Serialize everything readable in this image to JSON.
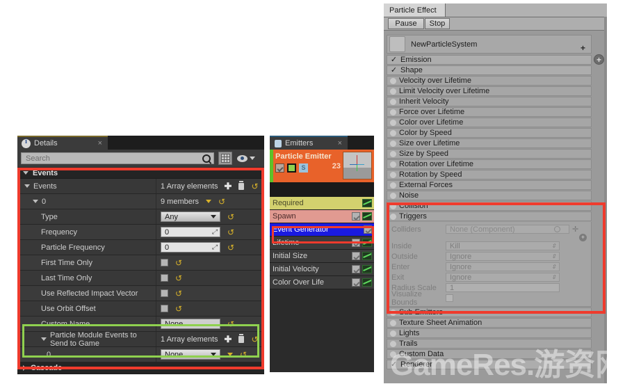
{
  "details_panel": {
    "tab": {
      "title": "Details",
      "icon": "info-icon",
      "close": "×"
    },
    "search": {
      "placeholder": "Search",
      "magnifier_icon": "search-icon",
      "grid_icon": "grid-view-icon",
      "eye_icon": "eye-icon"
    },
    "category": {
      "label": "Events"
    },
    "rows": [
      {
        "label": "Events",
        "value": "1 Array elements",
        "kind": "array",
        "indent": 1
      },
      {
        "label": "0",
        "value": "9 members",
        "kind": "members",
        "indent": 2
      },
      {
        "label": "Type",
        "value": "Any",
        "kind": "combo",
        "indent": 3
      },
      {
        "label": "Frequency",
        "value": "0",
        "kind": "num",
        "indent": 3
      },
      {
        "label": "Particle Frequency",
        "value": "0",
        "kind": "num",
        "indent": 3
      },
      {
        "label": "First Time Only",
        "value": "",
        "kind": "check",
        "indent": 3
      },
      {
        "label": "Last Time Only",
        "value": "",
        "kind": "check",
        "indent": 3
      },
      {
        "label": "Use Reflected Impact Vector",
        "value": "",
        "kind": "check",
        "indent": 3
      },
      {
        "label": "Use Orbit Offset",
        "value": "",
        "kind": "check",
        "indent": 3
      },
      {
        "label": "Custom Name",
        "value": "None",
        "kind": "text",
        "indent": 3
      },
      {
        "label": "Particle Module Events to Send to Game",
        "value": "1 Array elements",
        "kind": "array",
        "indent": 3
      },
      {
        "label": "0",
        "value": "None",
        "kind": "combo2",
        "indent": 4
      }
    ],
    "footer_category": {
      "label": "Cascade"
    },
    "highlight_color": "#ef3b2d",
    "group_highlight_color": "#8fd14f"
  },
  "emitters_panel": {
    "tab": {
      "title": "Emitters",
      "icon": "emitter-icon",
      "close": "×"
    },
    "emitter": {
      "name": "Particle Emitter",
      "count": "23",
      "icons": [
        "enabled-checkbox",
        "emitter-render-icon",
        "solo-s-icon"
      ],
      "thumbnail": "emitter-thumbnail"
    },
    "modules": [
      {
        "label": "Required",
        "bg": "#d3d16e",
        "fg": "#4a4a2a",
        "checkbox": false,
        "graph": true
      },
      {
        "label": "Spawn",
        "bg": "#e19a91",
        "fg": "#4a2a2a",
        "checkbox": true,
        "graph": true
      },
      {
        "label": "Event Generator",
        "bg": "#1a1ae0",
        "fg": "#ffffff",
        "checkbox": true,
        "graph": false,
        "selected": true
      },
      {
        "label": "Lifetime",
        "bg": "#3b3b3b",
        "fg": "#d2d2d2",
        "checkbox": true,
        "graph": true
      },
      {
        "label": "Initial Size",
        "bg": "#3b3b3b",
        "fg": "#d2d2d2",
        "checkbox": true,
        "graph": true
      },
      {
        "label": "Initial Velocity",
        "bg": "#3b3b3b",
        "fg": "#d2d2d2",
        "checkbox": true,
        "graph": true
      },
      {
        "label": "Color Over Life",
        "bg": "#3b3b3b",
        "fg": "#d2d2d2",
        "checkbox": true,
        "graph": true
      }
    ],
    "highlight_color": "#ef3b2d"
  },
  "unity_panel": {
    "tab": {
      "label": "Particle Effect"
    },
    "toolbar": {
      "pause": "Pause",
      "stop": "Stop"
    },
    "header": {
      "name": "NewParticleSystem",
      "plus": "+",
      "add_button": "+"
    },
    "modules": [
      {
        "label": "Emission",
        "state": "checked"
      },
      {
        "label": "Shape",
        "state": "checked"
      },
      {
        "label": "Velocity over Lifetime",
        "state": "off"
      },
      {
        "label": "Limit Velocity over Lifetime",
        "state": "off"
      },
      {
        "label": "Inherit Velocity",
        "state": "off"
      },
      {
        "label": "Force over Lifetime",
        "state": "off"
      },
      {
        "label": "Color over Lifetime",
        "state": "off"
      },
      {
        "label": "Color by Speed",
        "state": "off"
      },
      {
        "label": "Size over Lifetime",
        "state": "off"
      },
      {
        "label": "Size by Speed",
        "state": "off"
      },
      {
        "label": "Rotation over Lifetime",
        "state": "off"
      },
      {
        "label": "Rotation by Speed",
        "state": "off"
      },
      {
        "label": "External Forces",
        "state": "off"
      },
      {
        "label": "Noise",
        "state": "off"
      },
      {
        "label": "Collision",
        "state": "off"
      },
      {
        "label": "Triggers",
        "state": "off"
      }
    ],
    "triggers_panel": {
      "colliders_label": "Colliders",
      "colliders_value": "None (Component)",
      "fields": [
        {
          "label": "Inside",
          "value": "Kill",
          "kind": "dropdown"
        },
        {
          "label": "Outside",
          "value": "Ignore",
          "kind": "dropdown"
        },
        {
          "label": "Enter",
          "value": "Ignore",
          "kind": "dropdown"
        },
        {
          "label": "Exit",
          "value": "Ignore",
          "kind": "dropdown"
        },
        {
          "label": "Radius Scale",
          "value": "1",
          "kind": "number"
        },
        {
          "label": "Visualize Bounds",
          "value": "",
          "kind": "checkbox"
        }
      ]
    },
    "modules_after": [
      {
        "label": "Sub Emitters",
        "state": "off"
      },
      {
        "label": "Texture Sheet Animation",
        "state": "off"
      },
      {
        "label": "Lights",
        "state": "off"
      },
      {
        "label": "Trails",
        "state": "off"
      },
      {
        "label": "Custom Data",
        "state": "off"
      },
      {
        "label": "Renderer",
        "state": "checked"
      }
    ],
    "highlight_color": "#ef3b2d"
  },
  "watermark": {
    "latin": "GameRes.",
    "cjk": "游资网"
  }
}
